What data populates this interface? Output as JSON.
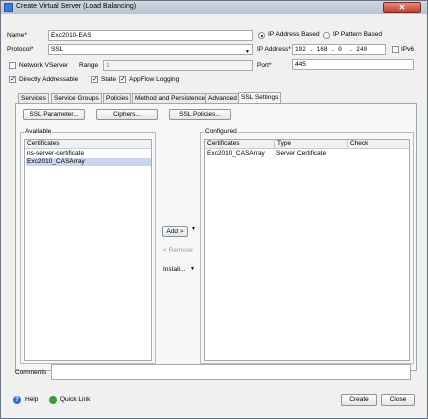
{
  "window": {
    "title": "Create Virtual Server (Load Balancing)",
    "close_glyph": "✕"
  },
  "form": {
    "name_label": "Name*",
    "name_value": "Exc2010-EAS",
    "protocol_label": "Protocol*",
    "protocol_value": "SSL",
    "network_vserver_label": "Network VServer",
    "range_label": "Range",
    "range_value": "1",
    "directly_addressable_label": "Directly Addressable",
    "state_label": "State",
    "appflow_label": "AppFlow Logging",
    "ip_based_label": "IP Address Based",
    "ip_pattern_label": "IP Pattern Based",
    "ip_address_label": "IP Address*",
    "ip_octets": [
      "192",
      "168",
      "0",
      "240"
    ],
    "ipv6_label": "IPv6",
    "port_label": "Port*",
    "port_value": "445"
  },
  "tabs": [
    "Services",
    "Service Groups",
    "Policies",
    "Method and Persistence",
    "Advanced",
    "SSL Settings"
  ],
  "ssl_buttons": {
    "ssl_parameter": "SSL Parameter...",
    "ciphers": "Ciphers...",
    "ssl_policies": "SSL Policies..."
  },
  "available": {
    "title": "Available",
    "column": "Certificates",
    "rows": [
      "ns-server-certificate",
      "Exc2010_CASArray"
    ]
  },
  "configured": {
    "title": "Configured",
    "columns": [
      "Certificates",
      "Type",
      "Check"
    ],
    "rows": [
      {
        "cert": "Exc2010_CASArray",
        "type": "Server Certificate",
        "check": ""
      }
    ]
  },
  "actions": {
    "add": "Add >",
    "remove": "< Remove",
    "install": "Install..."
  },
  "comments_label": "Comments",
  "footer": {
    "help": "Help",
    "quick_link": "Quick Link",
    "create": "Create",
    "close": "Close"
  },
  "colors": {
    "selected_row": "#c9d7ee",
    "title_bar": "#b9c4d2"
  }
}
